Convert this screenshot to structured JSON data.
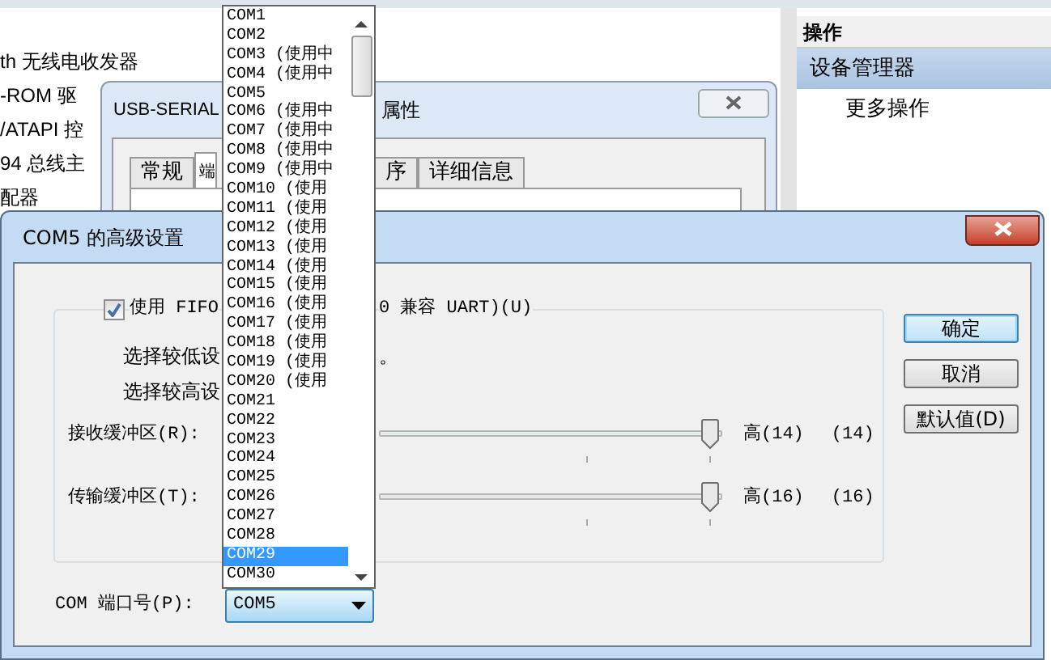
{
  "device_manager": {
    "tree_items": [
      "th 无线电收发器",
      "-ROM 驱",
      "/ATAPI 控",
      "94 总线主",
      "配器"
    ],
    "actions_panel": {
      "header": "操作",
      "items": [
        {
          "label": "设备管理器",
          "selected": true
        },
        {
          "label": "更多操作",
          "selected": false
        }
      ]
    }
  },
  "properties_window": {
    "title_parts": [
      "USB-SERIAL",
      "属性"
    ],
    "tabs": [
      {
        "label": "常规",
        "selected": false
      },
      {
        "label": "端",
        "selected": true
      },
      {
        "label": "序",
        "selected": false
      },
      {
        "label": "详细信息",
        "selected": false
      }
    ]
  },
  "dialog": {
    "title": "COM5 的高级设置",
    "fifo": {
      "label_parts": [
        "使用 FIFO",
        "0 兼容 UART)(U)"
      ],
      "checked": true
    },
    "notes": [
      [
        "选择较低设",
        "。"
      ],
      [
        "选择较高设"
      ]
    ],
    "buffers": [
      {
        "label": "接收缓冲区(R):",
        "level": 1,
        "max_label": "高(14)",
        "reading": "(14)"
      },
      {
        "label": "传输缓冲区(T):",
        "level": 1,
        "max_label": "高(16)",
        "reading": "(16)"
      }
    ],
    "port": {
      "label": "COM 端口号(P):",
      "value": "COM5"
    },
    "buttons": [
      {
        "label": "确定",
        "default": true
      },
      {
        "label": "取消",
        "default": false
      },
      {
        "label": "默认值(D)",
        "default": false
      }
    ]
  },
  "port_list": {
    "items": [
      {
        "label": "COM1",
        "selected": false
      },
      {
        "label": "COM2",
        "selected": false
      },
      {
        "label": "COM3 (使用中",
        "selected": false
      },
      {
        "label": "COM4 (使用中",
        "selected": false
      },
      {
        "label": "COM5",
        "selected": false
      },
      {
        "label": "COM6 (使用中",
        "selected": false
      },
      {
        "label": "COM7 (使用中",
        "selected": false
      },
      {
        "label": "COM8 (使用中",
        "selected": false
      },
      {
        "label": "COM9 (使用中",
        "selected": false
      },
      {
        "label": "COM10 (使用",
        "selected": false
      },
      {
        "label": "COM11 (使用",
        "selected": false
      },
      {
        "label": "COM12 (使用",
        "selected": false
      },
      {
        "label": "COM13 (使用",
        "selected": false
      },
      {
        "label": "COM14 (使用",
        "selected": false
      },
      {
        "label": "COM15 (使用",
        "selected": false
      },
      {
        "label": "COM16 (使用",
        "selected": false
      },
      {
        "label": "COM17 (使用",
        "selected": false
      },
      {
        "label": "COM18 (使用",
        "selected": false
      },
      {
        "label": "COM19 (使用",
        "selected": false
      },
      {
        "label": "COM20 (使用",
        "selected": false
      },
      {
        "label": "COM21",
        "selected": false
      },
      {
        "label": "COM22",
        "selected": false
      },
      {
        "label": "COM23",
        "selected": false
      },
      {
        "label": "COM24",
        "selected": false
      },
      {
        "label": "COM25",
        "selected": false
      },
      {
        "label": "COM26",
        "selected": false
      },
      {
        "label": "COM27",
        "selected": false
      },
      {
        "label": "COM28",
        "selected": false
      },
      {
        "label": "COM29",
        "selected": true
      },
      {
        "label": "COM30",
        "selected": false
      }
    ]
  }
}
